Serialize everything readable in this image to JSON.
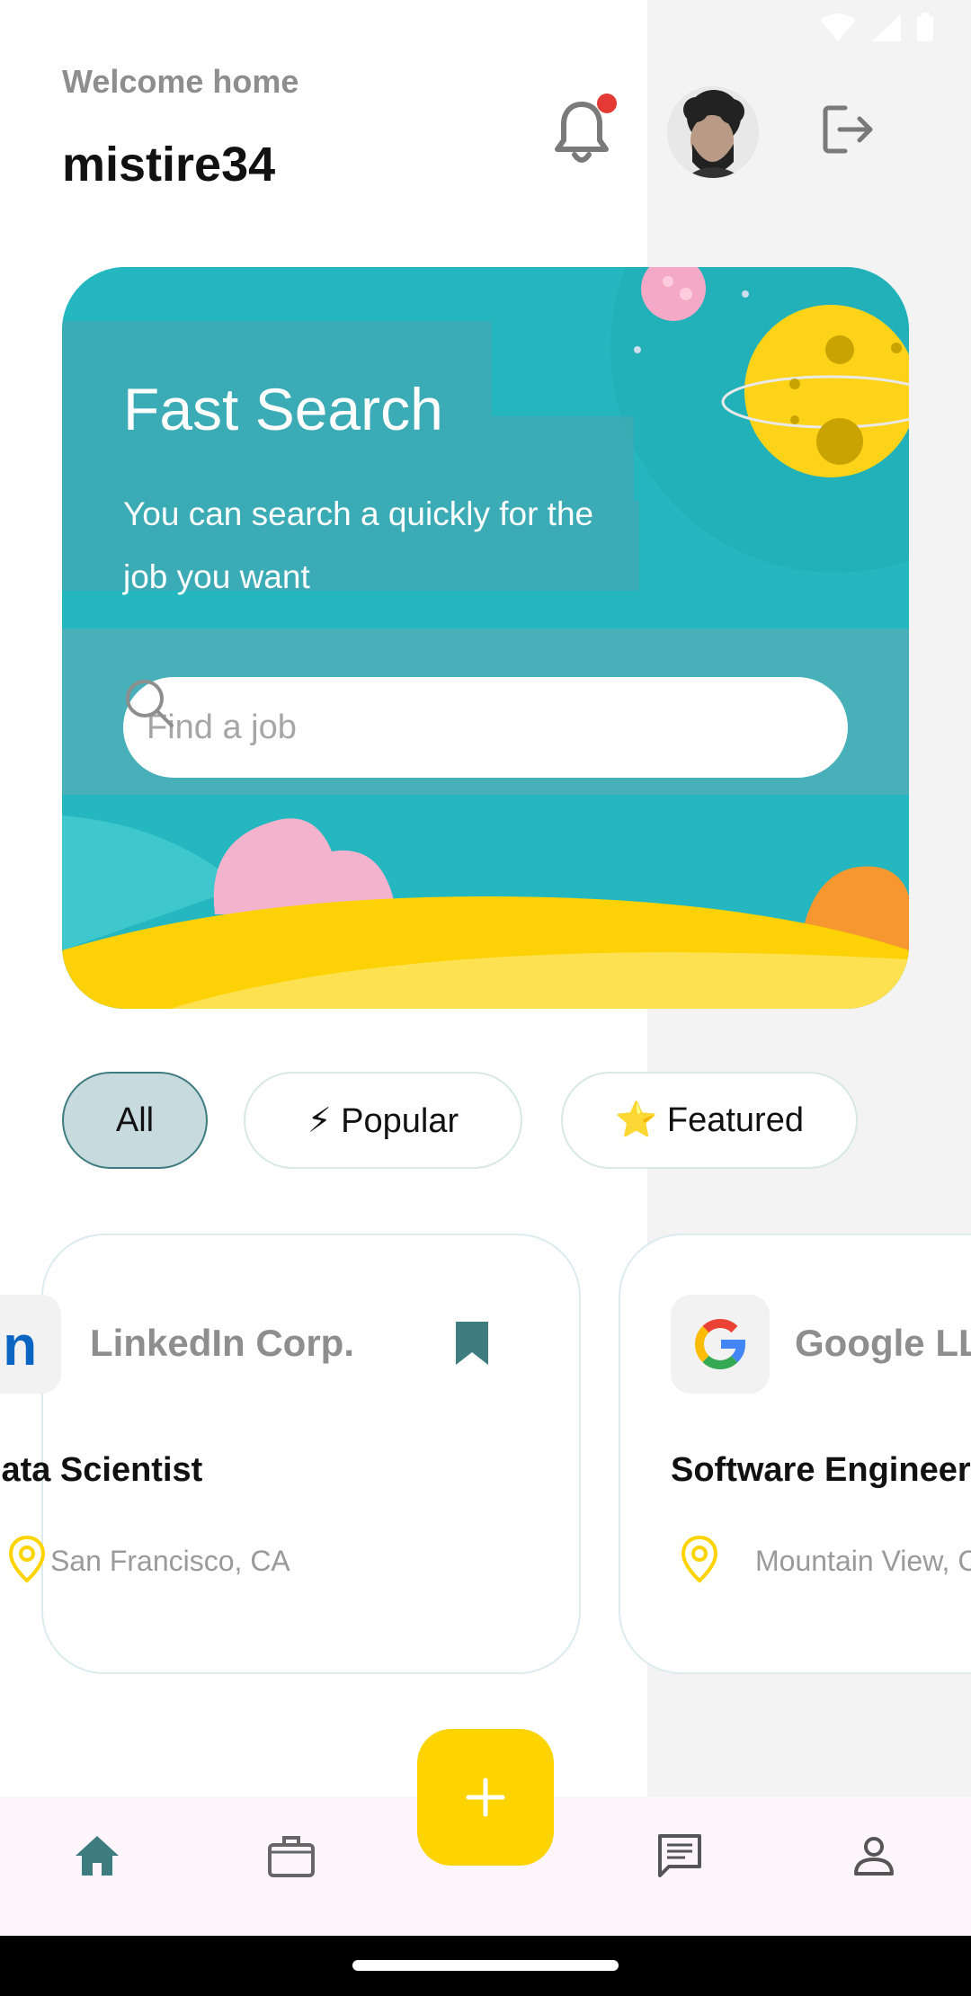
{
  "header": {
    "welcome": "Welcome home",
    "username": "mistire34"
  },
  "banner": {
    "title": "Fast Search",
    "description": "You can search a quickly for the job you want",
    "search_placeholder": "Find a job"
  },
  "filters": [
    {
      "label": "All",
      "active": true
    },
    {
      "label": "⚡ Popular",
      "active": false
    },
    {
      "label": "⭐ Featured",
      "active": false
    }
  ],
  "jobs": [
    {
      "company": "LinkedIn Corp.",
      "title": "Data Scientist",
      "location": "San Francisco, CA",
      "logo": "linkedin-logo",
      "bookmarked": true
    },
    {
      "company": "Google LLC",
      "title": "Software Engineer",
      "location": "Mountain View, CA",
      "logo": "google-logo",
      "bookmarked": false
    }
  ],
  "nav": {
    "items": [
      "home-icon",
      "briefcase-icon",
      "add-icon",
      "chat-icon",
      "profile-icon"
    ],
    "active": "home-icon"
  },
  "colors": {
    "accent": "#3e7c80",
    "fab": "#fdd400",
    "banner": "#25b7bf",
    "notification_dot": "#e53935"
  }
}
